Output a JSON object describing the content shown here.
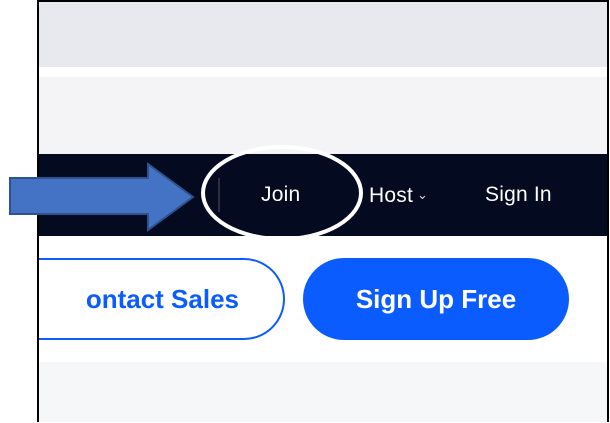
{
  "navbar": {
    "join_label": "Join",
    "host_label": "Host",
    "host_chevron": "⌄",
    "signin_label": "Sign In"
  },
  "buttons": {
    "contact_sales_label": "ontact Sales",
    "sign_up_label": "Sign Up Free"
  },
  "annotations": {
    "arrow_color": "#4472c4",
    "circle_color": "#ffffff"
  },
  "colors": {
    "navbar_bg": "#040a1f",
    "brand_blue": "#0b5cff"
  }
}
